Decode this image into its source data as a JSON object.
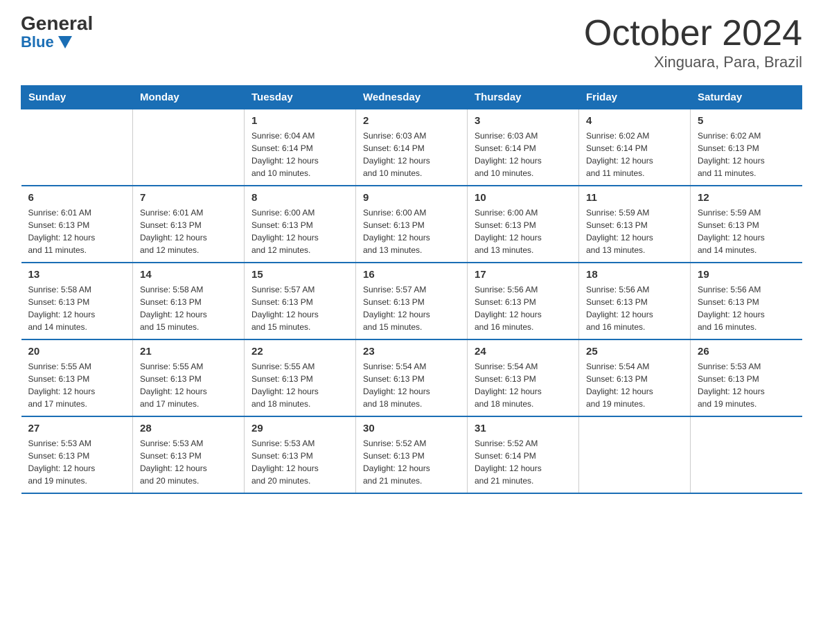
{
  "header": {
    "logo_general": "General",
    "logo_blue": "Blue",
    "month_title": "October 2024",
    "location": "Xinguara, Para, Brazil"
  },
  "weekdays": [
    "Sunday",
    "Monday",
    "Tuesday",
    "Wednesday",
    "Thursday",
    "Friday",
    "Saturday"
  ],
  "weeks": [
    [
      {
        "day": "",
        "info": ""
      },
      {
        "day": "",
        "info": ""
      },
      {
        "day": "1",
        "info": "Sunrise: 6:04 AM\nSunset: 6:14 PM\nDaylight: 12 hours\nand 10 minutes."
      },
      {
        "day": "2",
        "info": "Sunrise: 6:03 AM\nSunset: 6:14 PM\nDaylight: 12 hours\nand 10 minutes."
      },
      {
        "day": "3",
        "info": "Sunrise: 6:03 AM\nSunset: 6:14 PM\nDaylight: 12 hours\nand 10 minutes."
      },
      {
        "day": "4",
        "info": "Sunrise: 6:02 AM\nSunset: 6:14 PM\nDaylight: 12 hours\nand 11 minutes."
      },
      {
        "day": "5",
        "info": "Sunrise: 6:02 AM\nSunset: 6:13 PM\nDaylight: 12 hours\nand 11 minutes."
      }
    ],
    [
      {
        "day": "6",
        "info": "Sunrise: 6:01 AM\nSunset: 6:13 PM\nDaylight: 12 hours\nand 11 minutes."
      },
      {
        "day": "7",
        "info": "Sunrise: 6:01 AM\nSunset: 6:13 PM\nDaylight: 12 hours\nand 12 minutes."
      },
      {
        "day": "8",
        "info": "Sunrise: 6:00 AM\nSunset: 6:13 PM\nDaylight: 12 hours\nand 12 minutes."
      },
      {
        "day": "9",
        "info": "Sunrise: 6:00 AM\nSunset: 6:13 PM\nDaylight: 12 hours\nand 13 minutes."
      },
      {
        "day": "10",
        "info": "Sunrise: 6:00 AM\nSunset: 6:13 PM\nDaylight: 12 hours\nand 13 minutes."
      },
      {
        "day": "11",
        "info": "Sunrise: 5:59 AM\nSunset: 6:13 PM\nDaylight: 12 hours\nand 13 minutes."
      },
      {
        "day": "12",
        "info": "Sunrise: 5:59 AM\nSunset: 6:13 PM\nDaylight: 12 hours\nand 14 minutes."
      }
    ],
    [
      {
        "day": "13",
        "info": "Sunrise: 5:58 AM\nSunset: 6:13 PM\nDaylight: 12 hours\nand 14 minutes."
      },
      {
        "day": "14",
        "info": "Sunrise: 5:58 AM\nSunset: 6:13 PM\nDaylight: 12 hours\nand 15 minutes."
      },
      {
        "day": "15",
        "info": "Sunrise: 5:57 AM\nSunset: 6:13 PM\nDaylight: 12 hours\nand 15 minutes."
      },
      {
        "day": "16",
        "info": "Sunrise: 5:57 AM\nSunset: 6:13 PM\nDaylight: 12 hours\nand 15 minutes."
      },
      {
        "day": "17",
        "info": "Sunrise: 5:56 AM\nSunset: 6:13 PM\nDaylight: 12 hours\nand 16 minutes."
      },
      {
        "day": "18",
        "info": "Sunrise: 5:56 AM\nSunset: 6:13 PM\nDaylight: 12 hours\nand 16 minutes."
      },
      {
        "day": "19",
        "info": "Sunrise: 5:56 AM\nSunset: 6:13 PM\nDaylight: 12 hours\nand 16 minutes."
      }
    ],
    [
      {
        "day": "20",
        "info": "Sunrise: 5:55 AM\nSunset: 6:13 PM\nDaylight: 12 hours\nand 17 minutes."
      },
      {
        "day": "21",
        "info": "Sunrise: 5:55 AM\nSunset: 6:13 PM\nDaylight: 12 hours\nand 17 minutes."
      },
      {
        "day": "22",
        "info": "Sunrise: 5:55 AM\nSunset: 6:13 PM\nDaylight: 12 hours\nand 18 minutes."
      },
      {
        "day": "23",
        "info": "Sunrise: 5:54 AM\nSunset: 6:13 PM\nDaylight: 12 hours\nand 18 minutes."
      },
      {
        "day": "24",
        "info": "Sunrise: 5:54 AM\nSunset: 6:13 PM\nDaylight: 12 hours\nand 18 minutes."
      },
      {
        "day": "25",
        "info": "Sunrise: 5:54 AM\nSunset: 6:13 PM\nDaylight: 12 hours\nand 19 minutes."
      },
      {
        "day": "26",
        "info": "Sunrise: 5:53 AM\nSunset: 6:13 PM\nDaylight: 12 hours\nand 19 minutes."
      }
    ],
    [
      {
        "day": "27",
        "info": "Sunrise: 5:53 AM\nSunset: 6:13 PM\nDaylight: 12 hours\nand 19 minutes."
      },
      {
        "day": "28",
        "info": "Sunrise: 5:53 AM\nSunset: 6:13 PM\nDaylight: 12 hours\nand 20 minutes."
      },
      {
        "day": "29",
        "info": "Sunrise: 5:53 AM\nSunset: 6:13 PM\nDaylight: 12 hours\nand 20 minutes."
      },
      {
        "day": "30",
        "info": "Sunrise: 5:52 AM\nSunset: 6:13 PM\nDaylight: 12 hours\nand 21 minutes."
      },
      {
        "day": "31",
        "info": "Sunrise: 5:52 AM\nSunset: 6:14 PM\nDaylight: 12 hours\nand 21 minutes."
      },
      {
        "day": "",
        "info": ""
      },
      {
        "day": "",
        "info": ""
      }
    ]
  ]
}
